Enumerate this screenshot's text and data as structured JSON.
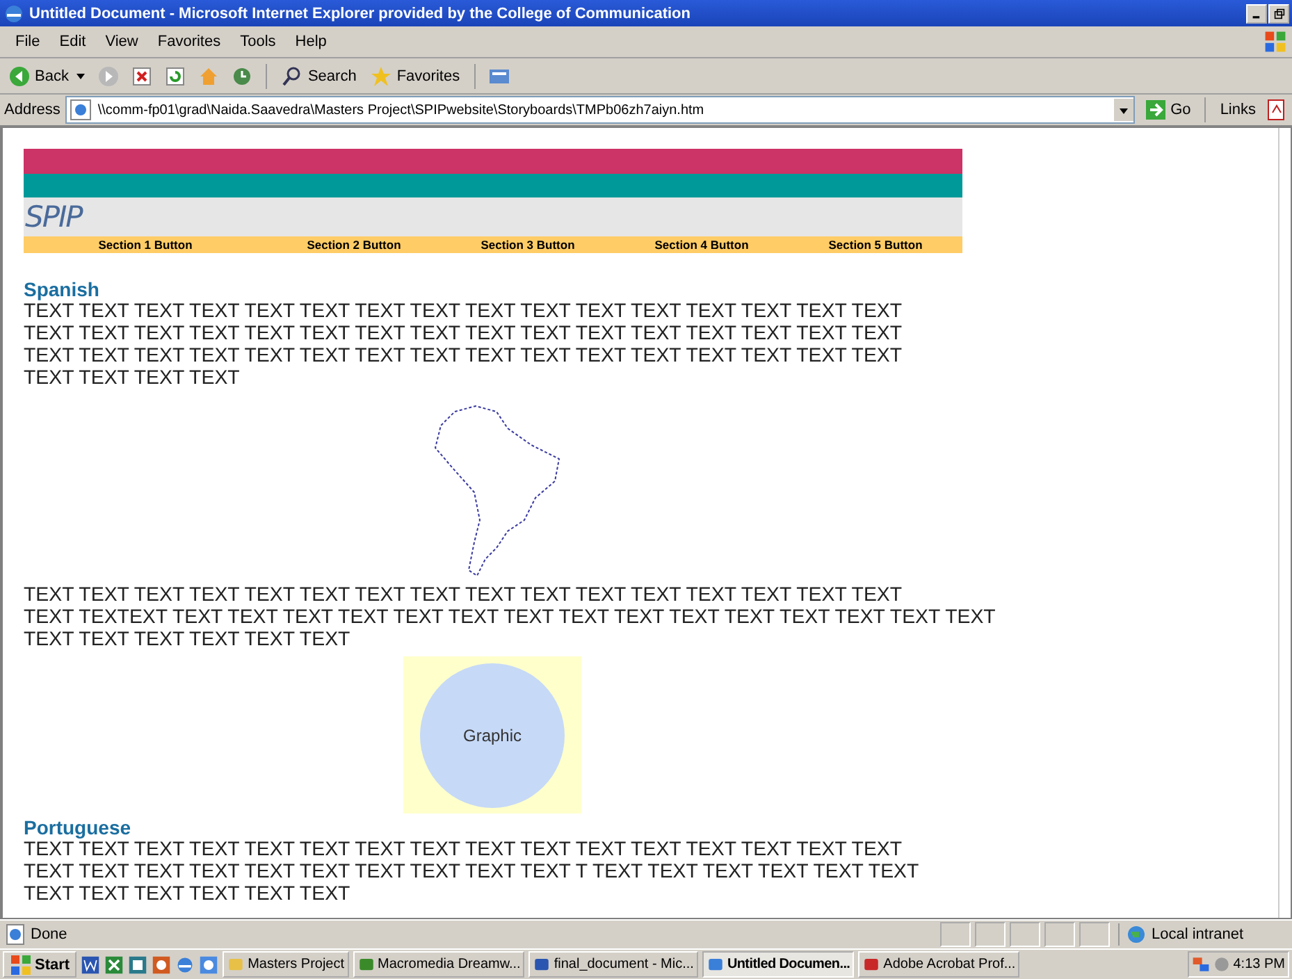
{
  "window": {
    "title": "Untitled Document - Microsoft Internet Explorer provided by the College of Communication"
  },
  "menu": [
    "File",
    "Edit",
    "View",
    "Favorites",
    "Tools",
    "Help"
  ],
  "toolbar": {
    "back": "Back",
    "search": "Search",
    "favorites": "Favorites"
  },
  "address_bar": {
    "label": "Address",
    "url": "\\\\comm-fp01\\grad\\Naida.Saavedra\\Masters Project\\SPIPwebsite\\Storyboards\\TMPb06zh7aiyn.htm",
    "go": "Go",
    "links": "Links"
  },
  "page": {
    "logo": "SPIP",
    "nav": [
      "Section 1 Button",
      "Section 2 Button",
      "Section 3 Button",
      "Section 4 Button",
      "Section 5 Button"
    ],
    "sections": [
      {
        "kind": "heading",
        "text": "Spanish"
      },
      {
        "kind": "paragraph",
        "text": "TEXT TEXT TEXT TEXT TEXT TEXT TEXT TEXT TEXT TEXT TEXT TEXT TEXT TEXT TEXT TEXT\nTEXT TEXT TEXT TEXT TEXT TEXT TEXT TEXT TEXT TEXT TEXT TEXT TEXT TEXT TEXT TEXT\nTEXT TEXT TEXT TEXT TEXT TEXT TEXT TEXT TEXT TEXT TEXT TEXT TEXT TEXT TEXT TEXT\nTEXT TEXT TEXT TEXT"
      },
      {
        "kind": "map"
      },
      {
        "kind": "paragraph",
        "text": "TEXT TEXT TEXT TEXT TEXT TEXT TEXT TEXT TEXT TEXT TEXT TEXT TEXT TEXT TEXT TEXT\nTEXT TEXTEXT TEXT TEXT TEXT TEXT TEXT TEXT TEXT TEXT TEXT TEXT TEXT TEXT TEXT TEXT TEXT\nTEXT TEXT TEXT TEXT TEXT TEXT"
      },
      {
        "kind": "graphic",
        "text": "Graphic"
      },
      {
        "kind": "heading",
        "text": "Portuguese"
      },
      {
        "kind": "paragraph",
        "text": "TEXT TEXT TEXT TEXT TEXT TEXT TEXT TEXT TEXT TEXT TEXT TEXT TEXT TEXT TEXT TEXT\nTEXT TEXT TEXT TEXT TEXT TEXT TEXT TEXT TEXT TEXT T TEXT TEXT TEXT TEXT TEXT TEXT\nTEXT TEXT TEXT TEXT TEXT TEXT"
      }
    ]
  },
  "status_bar": {
    "status": "Done",
    "zone": "Local intranet"
  },
  "taskbar": {
    "start": "Start",
    "tasks": [
      {
        "label": "Masters Project",
        "kind": "folder",
        "selected": false
      },
      {
        "label": "Macromedia Dreamw...",
        "kind": "dreamweaver",
        "selected": false
      },
      {
        "label": "final_document - Mic...",
        "kind": "word",
        "selected": false
      },
      {
        "label": "Untitled Documen...",
        "kind": "ie",
        "selected": true
      },
      {
        "label": "Adobe Acrobat Prof...",
        "kind": "acrobat",
        "selected": false
      }
    ],
    "clock": "4:13 PM"
  }
}
